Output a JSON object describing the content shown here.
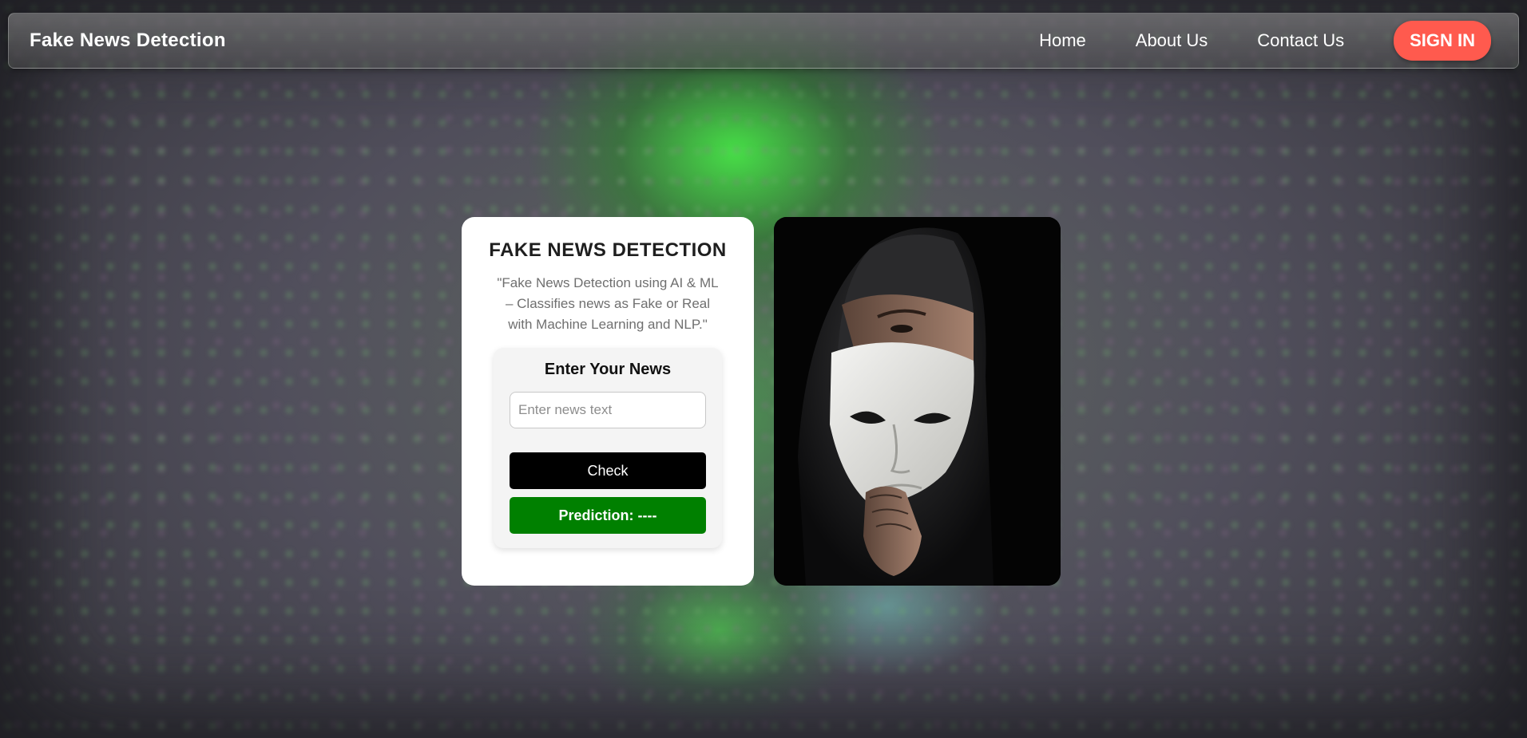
{
  "navbar": {
    "brand": "Fake News Detection",
    "links": [
      "Home",
      "About Us",
      "Contact Us"
    ],
    "signin_label": "SIGN IN"
  },
  "card": {
    "title": "FAKE NEWS DETECTION",
    "description": "\"Fake News Detection using AI & ML – Classifies news as Fake or Real with Machine Learning and NLP.\"",
    "form": {
      "title": "Enter Your News",
      "input_placeholder": "Enter news text",
      "input_value": "",
      "check_label": "Check",
      "prediction_text": "Prediction: ----"
    }
  },
  "colors": {
    "signin": "#ff5a4e",
    "check_button": "#000000",
    "prediction": "#008000"
  },
  "image_panel": {
    "icon": "masked-hooded-man-image"
  }
}
